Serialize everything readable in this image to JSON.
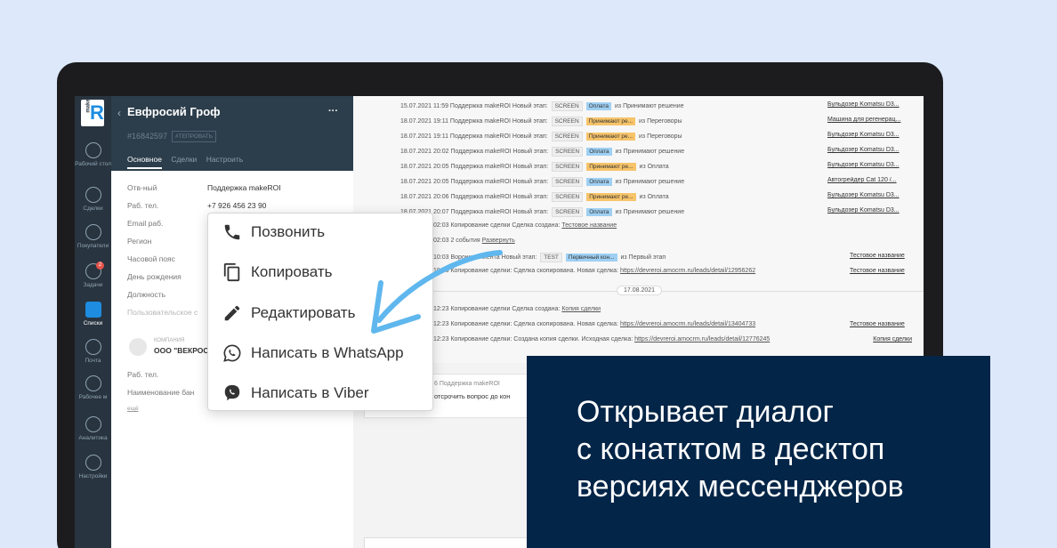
{
  "nav": {
    "logo_small": "make",
    "logo_letter": "R",
    "items": [
      {
        "label": "Рабочий стол"
      },
      {
        "label": "Сделки"
      },
      {
        "label": "Покупатели"
      },
      {
        "label": "Задачи",
        "badge": "2"
      },
      {
        "label": "Списки"
      },
      {
        "label": "Почта"
      },
      {
        "label": "Рабочее м"
      },
      {
        "label": "Аналитика"
      },
      {
        "label": "Настройки"
      }
    ]
  },
  "card": {
    "back_glyph": "‹",
    "name": "Евфросий Гроф",
    "menu_glyph": "···",
    "id": "#16842597",
    "tag": "#ТЕПРОВАТЬ",
    "tabs": [
      "Основное",
      "Сделки",
      "Настроить"
    ],
    "fields": [
      {
        "label": "Отв-ный",
        "value": "Поддержка makeROI"
      },
      {
        "label": "Раб. тел.",
        "value": "+7 926 456 23 90"
      },
      {
        "label": "Email раб.",
        "value": ""
      },
      {
        "label": "Регион",
        "value": ""
      },
      {
        "label": "Часовой пояс",
        "value": ""
      },
      {
        "label": "День рождения",
        "value": ""
      },
      {
        "label": "Должность",
        "value": ""
      },
      {
        "label": "Пользовательское с",
        "value": ""
      }
    ],
    "company_label": "КОМПАНИЯ",
    "company_name": "ООО \"ВЕКРОС",
    "company_fields": [
      {
        "label": "Раб. тел."
      },
      {
        "label": "Наименование бан"
      }
    ],
    "more": "ещё"
  },
  "feed": {
    "rows": [
      {
        "time": "15.07.2021 11:59 Поддержка makeROI Новый этап:",
        "src": "SCREEN",
        "stage": "Оплата",
        "stage_kind": "pay",
        "from": "из Принимают решение",
        "right": "Бульдозер Komatsu D3..."
      },
      {
        "time": "18.07.2021 19:11 Поддержка makeROI Новый этап:",
        "src": "SCREEN",
        "stage": "Принимают ре...",
        "stage_kind": "dec",
        "from": "из Переговоры",
        "right": "Машина для регенерац..."
      },
      {
        "time": "18.07.2021 19:11 Поддержка makeROI Новый этап:",
        "src": "SCREEN",
        "stage": "Принимают ре...",
        "stage_kind": "dec",
        "from": "из Переговоры",
        "right": "Бульдозер Komatsu D3..."
      },
      {
        "time": "18.07.2021 20:02 Поддержка makeROI Новый этап:",
        "src": "SCREEN",
        "stage": "Оплата",
        "stage_kind": "pay",
        "from": "из Принимают решение",
        "right": "Бульдозер Komatsu D3..."
      },
      {
        "time": "18.07.2021 20:05 Поддержка makeROI Новый этап:",
        "src": "SCREEN",
        "stage": "Принимают ре...",
        "stage_kind": "dec",
        "from": "из Оплата",
        "right": "Бульдозер Komatsu D3..."
      },
      {
        "time": "18.07.2021 20:05 Поддержка makeROI Новый этап:",
        "src": "SCREEN",
        "stage": "Оплата",
        "stage_kind": "pay",
        "from": "из Принимают решение",
        "right": "Автогрейдер Cat 120 /..."
      },
      {
        "time": "18.07.2021 20:06 Поддержка makeROI Новый этап:",
        "src": "SCREEN",
        "stage": "Принимают ре...",
        "stage_kind": "dec",
        "from": "из Оплата",
        "right": "Бульдозер Komatsu D3..."
      },
      {
        "time": "18.07.2021 20:07 Поддержка makeROI Новый этап:",
        "src": "SCREEN",
        "stage": "Оплата",
        "stage_kind": "pay",
        "from": "из Принимают решение",
        "right": "Бульдозер Komatsu D3..."
      }
    ],
    "line9": "02:03 Копирование сделки Сделка создана:",
    "line9_link": "Тестовое название",
    "line10": "02:03 2 события",
    "line10_link": "Развернуть",
    "line11_a": "10:03 Воронка клиента Новый этап:",
    "line11_src": "TEST",
    "line11_stage": "Первичный кон...",
    "line11_from": "из Первый этап",
    "line11_right": "Тестовое название",
    "line12": "10:03 Копирование сделки: Сделка скопирована. Новая сделка:",
    "line12_link": "https://devreroi.amocrm.ru/leads/detail/12956262",
    "line12_right": "Тестовое название",
    "date_divider": "17.08.2021",
    "line13": "12:23 Копирование сделки Сделка создана:",
    "line13_link": "Копия сделки",
    "line14": "12:23 Копирование сделки: Сделка скопирована. Новая сделка:",
    "line14_link": "https://devreroi.amocrm.ru/leads/detail/13404733",
    "line14_right": "Тестовое название",
    "line15": "12:23 Копирование сделки: Создана копия сделки. Исходная сделка:",
    "line15_link": "https://devreroi.amocrm.ru/leads/detail/12776245",
    "line15_right": "Копия сделки",
    "compose_label": "6 Поддержка makeROI",
    "compose_text": "отсрочить вопрос до кон"
  },
  "context_menu": {
    "items": [
      {
        "label": "Позвонить",
        "icon": "phone-icon"
      },
      {
        "label": "Копировать",
        "icon": "copy-icon"
      },
      {
        "label": "Редактировать",
        "icon": "pencil-icon"
      },
      {
        "label": "Написать в WhatsApp",
        "icon": "whatsapp-icon"
      },
      {
        "label": "Написать в Viber",
        "icon": "viber-icon"
      }
    ]
  },
  "promo": {
    "line1": "Открывает диалог",
    "line2": "с конатктом в десктоп",
    "line3": "версиях мессенджеров"
  },
  "colors": {
    "background": "#dde9fb",
    "promo": "#032547",
    "accent": "#1e8ce0",
    "arrow": "#5fb7ee"
  }
}
